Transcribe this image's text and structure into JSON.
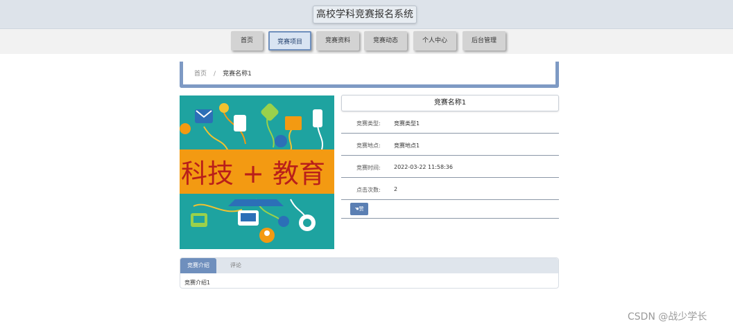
{
  "header": {
    "site_title": "高校学科竞赛报名系统"
  },
  "nav": [
    {
      "label": "首页",
      "active": false
    },
    {
      "label": "竞赛项目",
      "active": true
    },
    {
      "label": "竞赛资料",
      "active": false
    },
    {
      "label": "竞赛动态",
      "active": false
    },
    {
      "label": "个人中心",
      "active": false
    },
    {
      "label": "后台管理",
      "active": false
    }
  ],
  "breadcrumb": {
    "home": "首页",
    "separator": "/",
    "current": "竞赛名称1"
  },
  "hero_image": {
    "banner_text": "科技 + 教育"
  },
  "detail": {
    "title": "竞赛名称1",
    "rows": [
      {
        "key": "竞赛类型:",
        "value": "竞赛类型1"
      },
      {
        "key": "竞赛地点:",
        "value": "竞赛地点1"
      },
      {
        "key": "竞赛时间:",
        "value": "2022-03-22 11:58:36"
      },
      {
        "key": "点击次数:",
        "value": "2"
      }
    ],
    "like_button": "赞"
  },
  "tabs": [
    {
      "label": "竞赛介绍",
      "active": true
    },
    {
      "label": "评论",
      "active": false
    }
  ],
  "tab_content": "竞赛介绍1",
  "watermark": "CSDN @战少学长",
  "colors": {
    "accent": "#6f8fbd",
    "hero_bg": "#1ea3a0",
    "banner": "#f39a12"
  }
}
